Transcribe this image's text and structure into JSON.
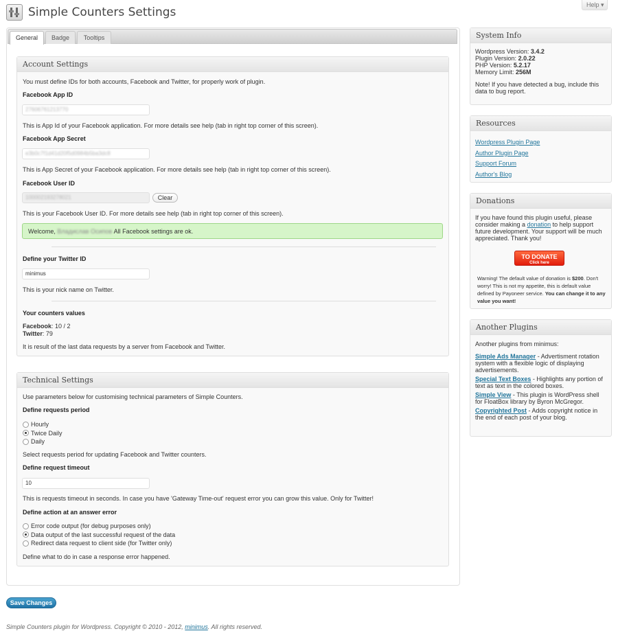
{
  "page": {
    "title": "Simple Counters Settings",
    "help": "Help ▾"
  },
  "tabs": [
    "General",
    "Badge",
    "Tooltips"
  ],
  "account": {
    "heading": "Account Settings",
    "intro": "You must define IDs for both accounts, Facebook and Twitter, for properly work of plugin.",
    "fb_app_id_label": "Facebook App ID",
    "fb_app_id_value": "27606761213770",
    "fb_app_id_help": "This is App Id of your Facebook application. For more details see help (tab in right top corner of this screen).",
    "fb_secret_label": "Facebook App Secret",
    "fb_secret_value": "e3b0c7f1d41d20f5d0984b5ba3dc8",
    "fb_secret_help": "This is App Secret of your Facebook application. For more details see help (tab in right top corner of this screen).",
    "fb_user_label": "Facebook User ID",
    "fb_user_value": "100002193278021",
    "clear_label": "Clear",
    "fb_user_help": "This is your Facebook User ID. For more details see help (tab in right top corner of this screen).",
    "welcome_prefix": "Welcome,",
    "welcome_name": "Владислав Осипов",
    "welcome_suffix": "All Facebook settings are ok.",
    "twitter_label": "Define your Twitter ID",
    "twitter_value": "minimus",
    "twitter_help": "This is your nick name on Twitter.",
    "counters_label": "Your counters values",
    "fb_counter_label": "Facebook",
    "fb_counter_value": ": 10 / 2",
    "tw_counter_label": "Twitter",
    "tw_counter_value": ": 79",
    "counters_help": "It is result of the last data requests by a server from Facebook and Twitter."
  },
  "technical": {
    "heading": "Technical Settings",
    "intro": "Use parameters below for customising technical parameters of Simple Counters.",
    "period_label": "Define requests period",
    "period_options": [
      {
        "label": "Hourly",
        "selected": false
      },
      {
        "label": "Twice Daily",
        "selected": true
      },
      {
        "label": "Daily",
        "selected": false
      }
    ],
    "period_help": "Select requests period for updating Facebook and Twitter counters.",
    "timeout_label": "Define request timeout",
    "timeout_value": "10",
    "timeout_help": "This is requests timeout in seconds. In case you have 'Gateway Time-out' request error you can grow this value. Only for Twitter!",
    "error_label": "Define action at an answer error",
    "error_options": [
      {
        "label": "Error code output (for debug purposes only)",
        "selected": false
      },
      {
        "label": "Data output of the last successful request of the data",
        "selected": true
      },
      {
        "label": "Redirect data request to client side (for Twitter only)",
        "selected": false
      }
    ],
    "error_help": "Define what to do in case a response error happened."
  },
  "save_label": "Save Changes",
  "footer": {
    "prefix": "Simple Counters plugin for Wordpress. Copyright © 2010 - 2012,",
    "link": "minimus",
    "suffix": ". All rights reserved."
  },
  "sidebar": {
    "system": {
      "heading": "System Info",
      "rows": [
        {
          "label": "Wordpress Version:",
          "value": "3.4.2"
        },
        {
          "label": "Plugin Version:",
          "value": "2.0.22"
        },
        {
          "label": "PHP Version:",
          "value": "5.2.17"
        },
        {
          "label": "Memory Limit:",
          "value": "256M"
        }
      ],
      "note": "Note! If you have detected a bug, include this data to bug report."
    },
    "resources": {
      "heading": "Resources",
      "links": [
        "Wordpress Plugin Page",
        "Author Plugin Page",
        "Support Forum",
        "Author's Blog"
      ]
    },
    "donations": {
      "heading": "Donations",
      "text_a": "If you have found this plugin useful, please consider making a",
      "link": "donation",
      "text_b": "to help support future development. Your support will be much appreciated. Thank you!",
      "button_main": "TO DONATE",
      "button_sub": "Click here",
      "warn_a": "Warning! The default value of donation is",
      "warn_amount": "$200",
      "warn_b": ". Don't worry! This is not my appetite, this is default value defined by Payoneer service.",
      "warn_bold": "You can change it to any value you want!"
    },
    "plugins": {
      "heading": "Another Plugins",
      "intro": "Another plugins from minimus:",
      "items": [
        {
          "name": "Simple Ads Manager",
          "desc": " - Advertisment rotation system with a flexible logic of displaying advertisements."
        },
        {
          "name": "Special Text Boxes",
          "desc": " - Highlights any portion of text as text in the colored boxes."
        },
        {
          "name": "Simple View",
          "desc": " - This plugin is WordPress shell for FloatBox library by Byron McGregor."
        },
        {
          "name": "Copyrighted Post",
          "desc": " - Adds copyright notice in the end of each post of your blog."
        }
      ]
    }
  }
}
